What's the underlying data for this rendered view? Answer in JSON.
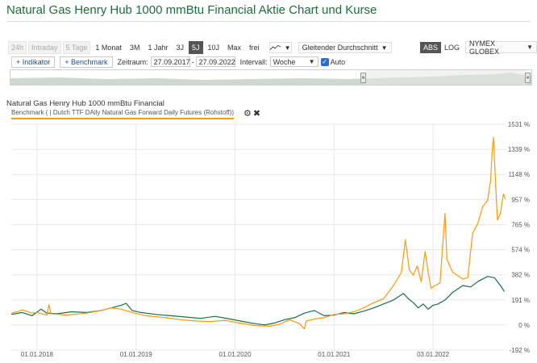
{
  "page": {
    "title": "Natural Gas Henry Hub 1000 mmBtu Financial Aktie Chart und Kurse"
  },
  "range_buttons": [
    {
      "label": "24h",
      "state": "disabled"
    },
    {
      "label": "Intraday",
      "state": "disabled"
    },
    {
      "label": "5 Tage",
      "state": "disabled"
    },
    {
      "label": "1 Monat",
      "state": "normal"
    },
    {
      "label": "3M",
      "state": "normal"
    },
    {
      "label": "1 Jahr",
      "state": "normal"
    },
    {
      "label": "3J",
      "state": "normal"
    },
    {
      "label": "5J",
      "state": "active"
    },
    {
      "label": "10J",
      "state": "normal"
    },
    {
      "label": "Max",
      "state": "normal"
    },
    {
      "label": "frei",
      "state": "normal"
    }
  ],
  "toolbar": {
    "chart_type_icon": "line-chart-icon",
    "overlay_select": "Gleitender Durchschnitt",
    "abs_label": "ABS",
    "log_label": "LOG",
    "exchange_select": "NYMEX GLOBEX",
    "indicator_button": "+ Indikator",
    "benchmark_button": "+ Benchmark",
    "period_label": "Zeitraum:",
    "date_from": "27.09.2017",
    "date_to": "27.09.2022",
    "interval_label": "Intervall:",
    "interval_value": "Woche",
    "auto_label": "Auto",
    "auto_checked": true
  },
  "chart_header": {
    "instrument": "Natural Gas Henry Hub 1000 mmBtu Financial",
    "benchmark": "Benchmark ( | Dutch TTF DAily Natural Gas Forward Daily Futures (Rohstoff))",
    "settings_icon": "gear-icon",
    "remove_icon": "close-icon"
  },
  "colors": {
    "primary": "#1e6b4a",
    "benchmark": "#f39c12",
    "title": "#1f6b3a",
    "active": "#555555"
  },
  "chart_data": {
    "type": "line",
    "x_labels": [
      "01.01.2018",
      "01.01.2019",
      "01.01.2020",
      "01.01.2021",
      "03.01.2022"
    ],
    "x_label_pos": [
      2018.0,
      2019.0,
      2020.0,
      2021.0,
      2022.0
    ],
    "y_ticks": [
      1531,
      1339,
      1148,
      957,
      765,
      574,
      382,
      191,
      0,
      -192
    ],
    "y_tick_labels": [
      "1531 %",
      "1339 %",
      "1148 %",
      "957 %",
      "765 %",
      "574 %",
      "382 %",
      "191 %",
      "0 %",
      "-192 %"
    ],
    "ylim": [
      -192,
      1531
    ],
    "xlim": [
      2017.74,
      2022.74
    ],
    "series": [
      {
        "color": "#1e6b4a",
        "points": [
          [
            2017.74,
            80
          ],
          [
            2017.85,
            95
          ],
          [
            2017.95,
            70
          ],
          [
            2018.04,
            120
          ],
          [
            2018.1,
            90
          ],
          [
            2018.2,
            85
          ],
          [
            2018.35,
            100
          ],
          [
            2018.5,
            95
          ],
          [
            2018.65,
            110
          ],
          [
            2018.75,
            130
          ],
          [
            2018.85,
            150
          ],
          [
            2018.9,
            165
          ],
          [
            2018.96,
            110
          ],
          [
            2019.05,
            95
          ],
          [
            2019.2,
            80
          ],
          [
            2019.35,
            70
          ],
          [
            2019.5,
            60
          ],
          [
            2019.65,
            50
          ],
          [
            2019.8,
            65
          ],
          [
            2019.95,
            45
          ],
          [
            2020.05,
            30
          ],
          [
            2020.2,
            10
          ],
          [
            2020.3,
            0
          ],
          [
            2020.4,
            15
          ],
          [
            2020.5,
            40
          ],
          [
            2020.6,
            55
          ],
          [
            2020.7,
            90
          ],
          [
            2020.8,
            110
          ],
          [
            2020.9,
            70
          ],
          [
            2021.0,
            75
          ],
          [
            2021.1,
            95
          ],
          [
            2021.2,
            85
          ],
          [
            2021.3,
            105
          ],
          [
            2021.4,
            130
          ],
          [
            2021.5,
            160
          ],
          [
            2021.6,
            190
          ],
          [
            2021.7,
            240
          ],
          [
            2021.75,
            200
          ],
          [
            2021.8,
            170
          ],
          [
            2021.85,
            130
          ],
          [
            2021.9,
            160
          ],
          [
            2021.95,
            120
          ],
          [
            2022.0,
            150
          ],
          [
            2022.05,
            160
          ],
          [
            2022.12,
            190
          ],
          [
            2022.2,
            250
          ],
          [
            2022.3,
            300
          ],
          [
            2022.38,
            290
          ],
          [
            2022.45,
            330
          ],
          [
            2022.55,
            370
          ],
          [
            2022.62,
            360
          ],
          [
            2022.68,
            300
          ],
          [
            2022.72,
            255
          ]
        ]
      },
      {
        "color": "#f39c12",
        "points": [
          [
            2017.74,
            90
          ],
          [
            2017.8,
            100
          ],
          [
            2017.85,
            115
          ],
          [
            2017.95,
            90
          ],
          [
            2018.0,
            95
          ],
          [
            2018.1,
            75
          ],
          [
            2018.12,
            155
          ],
          [
            2018.14,
            85
          ],
          [
            2018.3,
            75
          ],
          [
            2018.5,
            90
          ],
          [
            2018.65,
            110
          ],
          [
            2018.75,
            130
          ],
          [
            2018.85,
            120
          ],
          [
            2018.96,
            95
          ],
          [
            2019.1,
            70
          ],
          [
            2019.3,
            55
          ],
          [
            2019.45,
            40
          ],
          [
            2019.6,
            30
          ],
          [
            2019.75,
            25
          ],
          [
            2019.9,
            35
          ],
          [
            2020.0,
            20
          ],
          [
            2020.2,
            -5
          ],
          [
            2020.35,
            -10
          ],
          [
            2020.45,
            5
          ],
          [
            2020.55,
            40
          ],
          [
            2020.65,
            10
          ],
          [
            2020.7,
            -30
          ],
          [
            2020.72,
            30
          ],
          [
            2020.8,
            45
          ],
          [
            2020.9,
            55
          ],
          [
            2021.0,
            80
          ],
          [
            2021.1,
            85
          ],
          [
            2021.2,
            100
          ],
          [
            2021.3,
            130
          ],
          [
            2021.4,
            170
          ],
          [
            2021.5,
            200
          ],
          [
            2021.6,
            300
          ],
          [
            2021.68,
            400
          ],
          [
            2021.72,
            650
          ],
          [
            2021.76,
            420
          ],
          [
            2021.8,
            380
          ],
          [
            2021.84,
            450
          ],
          [
            2021.88,
            330
          ],
          [
            2021.92,
            560
          ],
          [
            2021.95,
            400
          ],
          [
            2021.98,
            280
          ],
          [
            2022.02,
            300
          ],
          [
            2022.07,
            320
          ],
          [
            2022.12,
            850
          ],
          [
            2022.14,
            500
          ],
          [
            2022.18,
            430
          ],
          [
            2022.2,
            400
          ],
          [
            2022.24,
            380
          ],
          [
            2022.3,
            350
          ],
          [
            2022.35,
            360
          ],
          [
            2022.4,
            700
          ],
          [
            2022.45,
            770
          ],
          [
            2022.5,
            900
          ],
          [
            2022.55,
            950
          ],
          [
            2022.58,
            1100
          ],
          [
            2022.6,
            1360
          ],
          [
            2022.61,
            1430
          ],
          [
            2022.63,
            1100
          ],
          [
            2022.65,
            800
          ],
          [
            2022.68,
            850
          ],
          [
            2022.71,
            1000
          ],
          [
            2022.73,
            960
          ]
        ]
      }
    ],
    "grid": true
  }
}
